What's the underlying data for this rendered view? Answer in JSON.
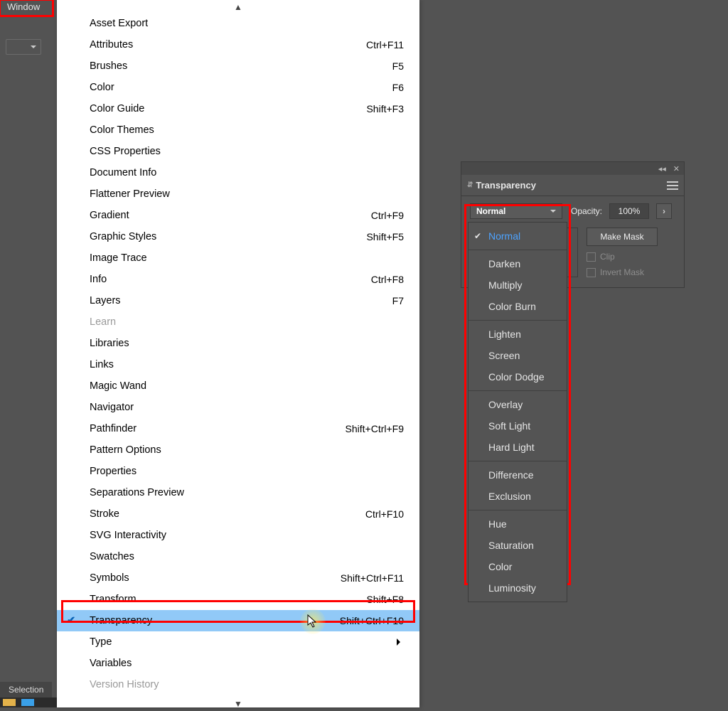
{
  "menubar": {
    "window_label": "Window"
  },
  "bottom": {
    "selection_label": "Selection"
  },
  "window_menu": {
    "items": [
      {
        "label": "Asset Export",
        "shortcut": ""
      },
      {
        "label": "Attributes",
        "shortcut": "Ctrl+F11"
      },
      {
        "label": "Brushes",
        "shortcut": "F5"
      },
      {
        "label": "Color",
        "shortcut": "F6"
      },
      {
        "label": "Color Guide",
        "shortcut": "Shift+F3"
      },
      {
        "label": "Color Themes",
        "shortcut": ""
      },
      {
        "label": "CSS Properties",
        "shortcut": ""
      },
      {
        "label": "Document Info",
        "shortcut": ""
      },
      {
        "label": "Flattener Preview",
        "shortcut": ""
      },
      {
        "label": "Gradient",
        "shortcut": "Ctrl+F9"
      },
      {
        "label": "Graphic Styles",
        "shortcut": "Shift+F5"
      },
      {
        "label": "Image Trace",
        "shortcut": ""
      },
      {
        "label": "Info",
        "shortcut": "Ctrl+F8"
      },
      {
        "label": "Layers",
        "shortcut": "F7"
      },
      {
        "label": "Learn",
        "shortcut": "",
        "disabled": true
      },
      {
        "label": "Libraries",
        "shortcut": ""
      },
      {
        "label": "Links",
        "shortcut": ""
      },
      {
        "label": "Magic Wand",
        "shortcut": ""
      },
      {
        "label": "Navigator",
        "shortcut": ""
      },
      {
        "label": "Pathfinder",
        "shortcut": "Shift+Ctrl+F9"
      },
      {
        "label": "Pattern Options",
        "shortcut": ""
      },
      {
        "label": "Properties",
        "shortcut": ""
      },
      {
        "label": "Separations Preview",
        "shortcut": ""
      },
      {
        "label": "Stroke",
        "shortcut": "Ctrl+F10"
      },
      {
        "label": "SVG Interactivity",
        "shortcut": ""
      },
      {
        "label": "Swatches",
        "shortcut": ""
      },
      {
        "label": "Symbols",
        "shortcut": "Shift+Ctrl+F11"
      },
      {
        "label": "Transform",
        "shortcut": "Shift+F8"
      },
      {
        "label": "Transparency",
        "shortcut": "Shift+Ctrl+F10",
        "checked": true,
        "highlighted": true
      },
      {
        "label": "Type",
        "shortcut": "",
        "submenu": true
      },
      {
        "label": "Variables",
        "shortcut": ""
      },
      {
        "label": "Version History",
        "shortcut": "",
        "disabled": true
      }
    ]
  },
  "panel": {
    "title": "Transparency",
    "blend_label": "Normal",
    "opacity_label": "Opacity:",
    "opacity_value": "100%",
    "make_mask": "Make Mask",
    "clip": "Clip",
    "invert": "Invert Mask"
  },
  "blend_modes": {
    "groups": [
      [
        "Normal"
      ],
      [
        "Darken",
        "Multiply",
        "Color Burn"
      ],
      [
        "Lighten",
        "Screen",
        "Color Dodge"
      ],
      [
        "Overlay",
        "Soft Light",
        "Hard Light"
      ],
      [
        "Difference",
        "Exclusion"
      ],
      [
        "Hue",
        "Saturation",
        "Color",
        "Luminosity"
      ]
    ],
    "selected": "Normal"
  }
}
